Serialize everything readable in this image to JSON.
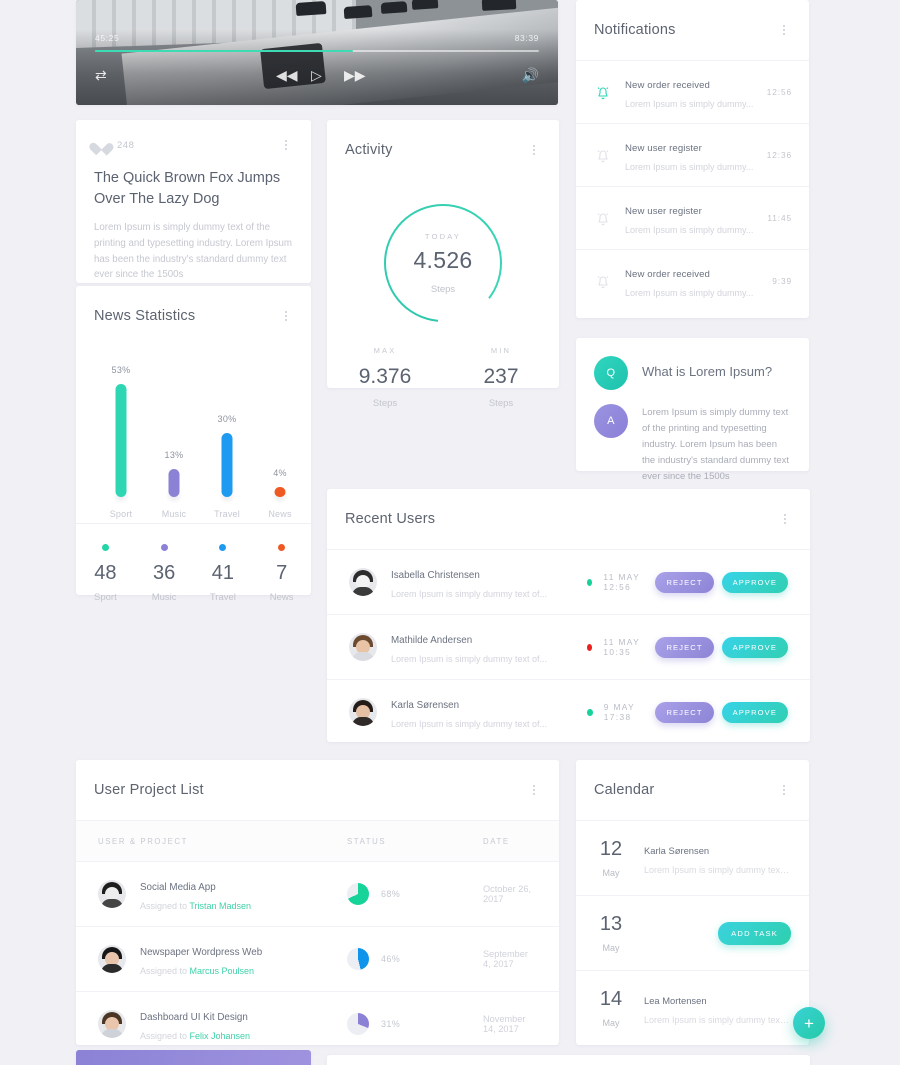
{
  "video": {
    "current_time": "45:25",
    "total_time": "83:39",
    "progress_percent": 58,
    "controls": [
      "repeat-icon",
      "rewind-icon",
      "play-icon",
      "forward-icon",
      "volume-icon"
    ]
  },
  "quote": {
    "likes": "248",
    "heart_icon": "heart-icon",
    "title": "The Quick Brown Fox Jumps Over The Lazy Dog",
    "body": "Lorem Ipsum is simply dummy text of the printing and typesetting industry. Lorem Ipsum has been the industry's standard dummy text ever since the 1500s"
  },
  "news": {
    "title": "News Statistics",
    "legend": [
      {
        "value": "48",
        "label": "Sport",
        "color": "#24d5a8"
      },
      {
        "value": "36",
        "label": "Music",
        "color": "#8b82d6"
      },
      {
        "value": "41",
        "label": "Travel",
        "color": "#1e9bf0"
      },
      {
        "value": "7",
        "label": "News",
        "color": "#ef5a24"
      }
    ]
  },
  "chart_data": {
    "type": "bar",
    "title": "News Statistics",
    "categories": [
      "Sport",
      "Music",
      "Travel",
      "News"
    ],
    "values": [
      53,
      13,
      30,
      4
    ],
    "value_labels": [
      "53%",
      "13%",
      "30%",
      "4%"
    ],
    "colors": [
      "#2fd6b4",
      "#8b82d6",
      "#1e9bf0",
      "#ef5a24"
    ],
    "xlabel": "",
    "ylabel": "",
    "ylim": [
      0,
      60
    ],
    "grid": false,
    "legend": false
  },
  "activity": {
    "title": "Activity",
    "today_label": "TODAY",
    "today_value": "4.526",
    "today_unit": "Steps",
    "ring_percent": 84,
    "ring_color": "#2fc8ae",
    "stats": [
      {
        "key": "MAX",
        "value": "9.376",
        "unit": "Steps"
      },
      {
        "key": "MIN",
        "value": "237",
        "unit": "Steps"
      }
    ]
  },
  "notifications": {
    "title": "Notifications",
    "items": [
      {
        "icon": "bell-icon",
        "title": "New order received",
        "sub": "Lorem Ipsum is simply dummy...",
        "time": "12:56",
        "active": true
      },
      {
        "icon": "bell-icon",
        "title": "New user register",
        "sub": "Lorem Ipsum is simply dummy...",
        "time": "12:36",
        "active": false
      },
      {
        "icon": "bell-icon",
        "title": "New user register",
        "sub": "Lorem Ipsum is simply dummy...",
        "time": "11:45",
        "active": false
      },
      {
        "icon": "bell-icon",
        "title": "New order received",
        "sub": "Lorem Ipsum is simply dummy...",
        "time": "9:39",
        "active": false
      }
    ]
  },
  "qa": {
    "q_badge": "Q",
    "a_badge": "A",
    "question": "What is Lorem Ipsum?",
    "answer": "Lorem Ipsum is simply dummy text of the printing and typesetting industry. Lorem Ipsum has been the industry's standard dummy text ever since the 1500s"
  },
  "recent_users": {
    "title": "Recent Users",
    "reject_label": "REJECT",
    "approve_label": "APPROVE",
    "rows": [
      {
        "name": "Isabella Christensen",
        "sub": "Lorem Ipsum is simply dummy text of...",
        "date": "11 MAY 12:56",
        "status_color": "#16d39a"
      },
      {
        "name": "Mathilde Andersen",
        "sub": "Lorem Ipsum is simply dummy text of...",
        "date": "11 MAY 10:35",
        "status_color": "#ec2121"
      },
      {
        "name": "Karla Sørensen",
        "sub": "Lorem Ipsum is simply dummy text of...",
        "date": "9 MAY 17:38",
        "status_color": "#16d39a"
      }
    ]
  },
  "projects": {
    "title": "User Project List",
    "columns": [
      "USER & PROJECT",
      "STATUS",
      "DATE"
    ],
    "rows": [
      {
        "name": "Social Media App",
        "assigned_prefix": "Assigned to ",
        "assignee": "Tristan Madsen",
        "percent": "68%",
        "pie_value": 68,
        "pie_color": "#16d39a",
        "date": "October 26, 2017"
      },
      {
        "name": "Newspaper Wordpress Web",
        "assigned_prefix": "Assigned to ",
        "assignee": "Marcus Poulsen",
        "percent": "46%",
        "pie_value": 46,
        "pie_color": "#0e94eb",
        "date": "September 4, 2017"
      },
      {
        "name": "Dashboard UI Kit Design",
        "assigned_prefix": "Assigned to ",
        "assignee": "Felix Johansen",
        "percent": "31%",
        "pie_value": 31,
        "pie_color": "#8b82d6",
        "date": "November 14, 2017"
      }
    ]
  },
  "calendar": {
    "title": "Calendar",
    "add_task_label": "ADD TASK",
    "fab_label": "+",
    "rows": [
      {
        "day": "12",
        "month": "May",
        "title": "Karla Sørensen",
        "sub": "Lorem Ipsum is simply dummy text of..."
      },
      {
        "day": "13",
        "month": "May",
        "title": "",
        "sub": ""
      },
      {
        "day": "14",
        "month": "May",
        "title": "Lea Mortensen",
        "sub": "Lorem Ipsum is simply dummy text of..."
      }
    ]
  }
}
